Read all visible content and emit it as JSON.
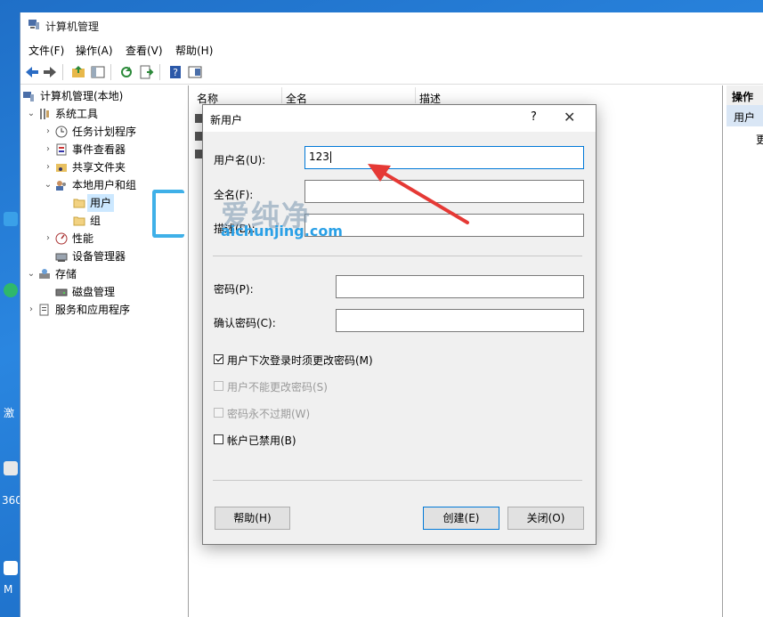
{
  "desktop": {
    "labels": [
      "激",
      "360",
      "M"
    ]
  },
  "window": {
    "title": "计算机管理",
    "menu": [
      "文件(F)",
      "操作(A)",
      "查看(V)",
      "帮助(H)"
    ]
  },
  "tree": {
    "root": "计算机管理(本地)",
    "items": [
      {
        "label": "系统工具"
      },
      {
        "label": "任务计划程序"
      },
      {
        "label": "事件查看器"
      },
      {
        "label": "共享文件夹"
      },
      {
        "label": "本地用户和组"
      },
      {
        "label": "用户"
      },
      {
        "label": "组"
      },
      {
        "label": "性能"
      },
      {
        "label": "设备管理器"
      },
      {
        "label": "存储"
      },
      {
        "label": "磁盘管理"
      },
      {
        "label": "服务和应用程序"
      }
    ]
  },
  "list": {
    "columns": [
      "名称",
      "全名",
      "描述"
    ]
  },
  "actions": {
    "header": "操作",
    "sub": "用户",
    "more": "更"
  },
  "dialog": {
    "title": "新用户",
    "help_glyph": "?",
    "close_glyph": "✕",
    "username_label": "用户名(U):",
    "username_value": "123",
    "fullname_label": "全名(F):",
    "description_label": "描述(D):",
    "password_label": "密码(P):",
    "confirm_label": "确认密码(C):",
    "checkboxes": [
      {
        "label": "用户下次登录时须更改密码(M)",
        "checked": true,
        "disabled": false
      },
      {
        "label": "用户不能更改密码(S)",
        "checked": false,
        "disabled": true
      },
      {
        "label": "密码永不过期(W)",
        "checked": false,
        "disabled": true
      },
      {
        "label": "帐户已禁用(B)",
        "checked": false,
        "disabled": false
      }
    ],
    "help_button": "帮助(H)",
    "create_button": "创建(E)",
    "close_button": "关闭(O)"
  },
  "watermark": {
    "text": "爱纯净",
    "url": "aichunjing.com"
  },
  "colors": {
    "accent": "#0078d7",
    "arrow": "#e53935",
    "selection": "#cce8ff"
  }
}
